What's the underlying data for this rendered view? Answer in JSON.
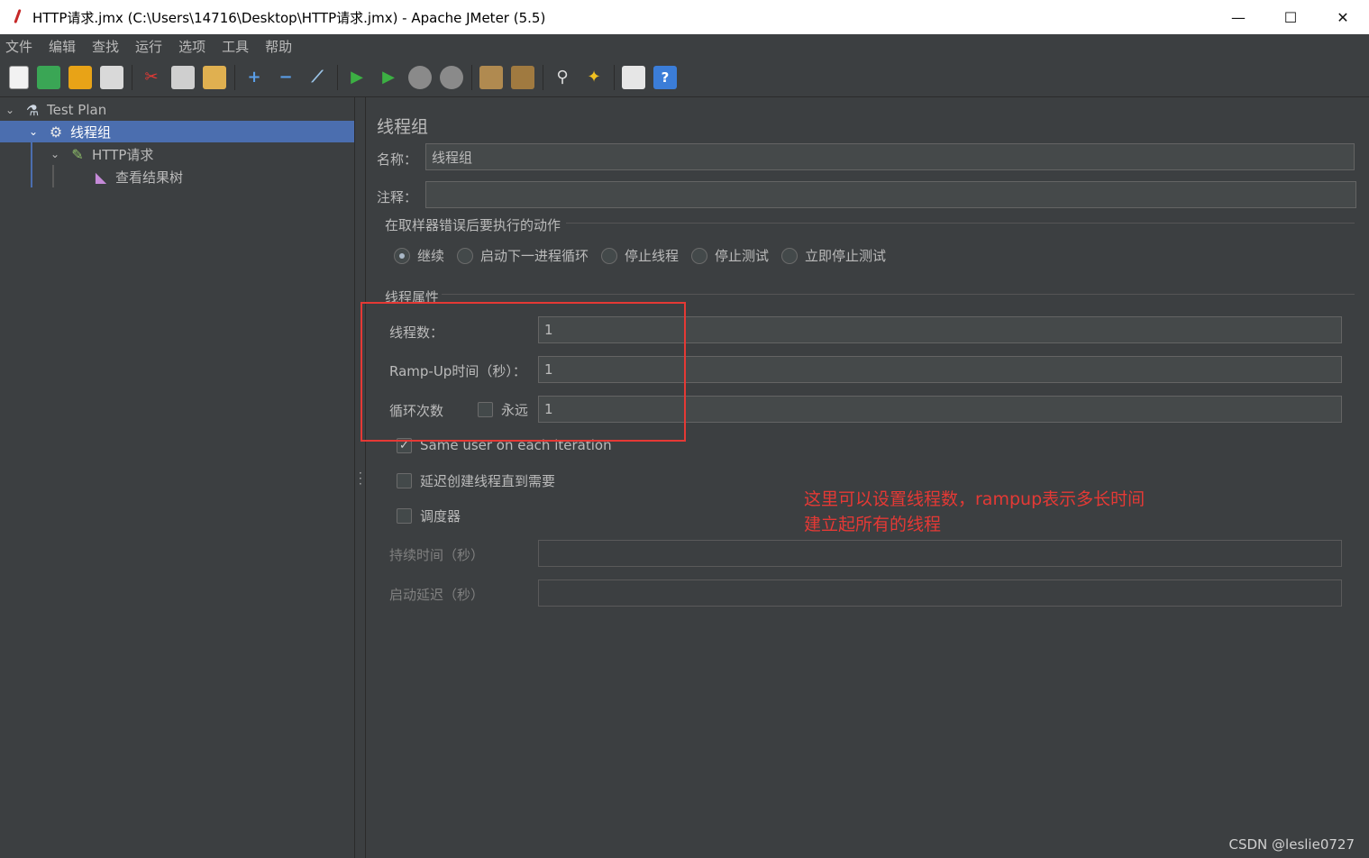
{
  "window": {
    "title": "HTTP请求.jmx (C:\\Users\\14716\\Desktop\\HTTP请求.jmx) - Apache JMeter (5.5)",
    "minimize": "—",
    "maximize": "☐",
    "close": "✕"
  },
  "menu": [
    "文件",
    "编辑",
    "查找",
    "运行",
    "选项",
    "工具",
    "帮助"
  ],
  "toolbar_icons": [
    "new-icon",
    "templates-icon",
    "open-icon",
    "save-icon",
    "cut-icon",
    "copy-icon",
    "paste-icon",
    "expand-icon",
    "collapse-icon",
    "toggle-icon",
    "start-icon",
    "start-no-pause-icon",
    "stop-icon",
    "shutdown-icon",
    "clear-icon",
    "clear-all-icon",
    "search-icon",
    "reset-search-icon",
    "function-helper-icon",
    "help-icon"
  ],
  "tree": {
    "test_plan": "Test Plan",
    "thread_group": "线程组",
    "http_request": "HTTP请求",
    "result_tree": "查看结果树"
  },
  "panel": {
    "title": "线程组",
    "name_label": "名称：",
    "name_value": "线程组",
    "comment_label": "注释：",
    "comment_value": "",
    "sampler_error_title": "在取样器错误后要执行的动作",
    "actions": [
      {
        "label": "继续",
        "selected": true
      },
      {
        "label": "启动下一进程循环",
        "selected": false
      },
      {
        "label": "停止线程",
        "selected": false
      },
      {
        "label": "停止测试",
        "selected": false
      },
      {
        "label": "立即停止测试",
        "selected": false
      }
    ],
    "thread_props_title": "线程属性",
    "threads_label": "线程数：",
    "threads_value": "1",
    "rampup_label": "Ramp-Up时间（秒）：",
    "rampup_value": "1",
    "loop_label": "循环次数",
    "forever_label": "永远",
    "forever_checked": false,
    "loop_value": "1",
    "same_user_label": "Same user on each iteration",
    "same_user_checked": true,
    "delay_label": "延迟创建线程直到需要",
    "delay_checked": false,
    "scheduler_label": "调度器",
    "scheduler_checked": false,
    "duration_label": "持续时间（秒）",
    "duration_value": "",
    "startup_delay_label": "启动延迟（秒）",
    "startup_delay_value": ""
  },
  "annotation": {
    "line1": "这里可以设置线程数，rampup表示多长时间",
    "line2": "建立起所有的线程",
    "color": "#e53935"
  },
  "watermark": "CSDN @leslie0727",
  "colors": {
    "background": "#3c3f41",
    "selection": "#4b6eaf",
    "text": "#bbbbbb"
  }
}
